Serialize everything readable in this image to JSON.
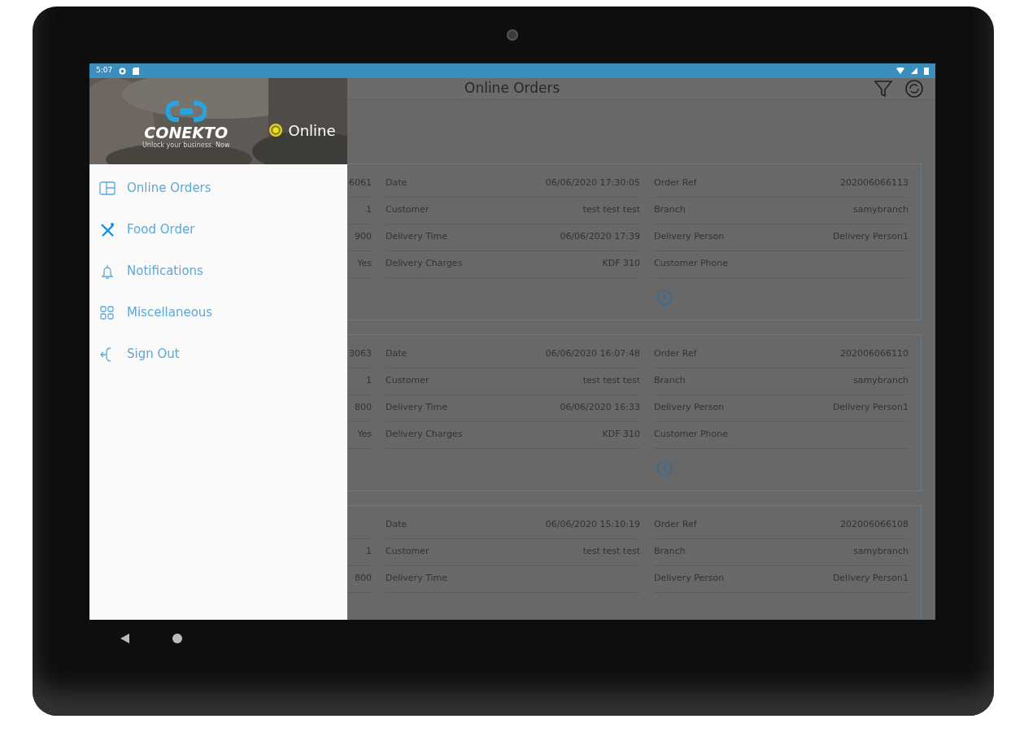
{
  "status_bar": {
    "time": "5:07"
  },
  "drawer": {
    "brand": "CONEKTO",
    "tagline": "Unlock your business. Now",
    "status": "Online",
    "items": [
      {
        "label": "Online Orders",
        "kind": "orders"
      },
      {
        "label": "Food Order",
        "kind": "food"
      },
      {
        "label": "Notifications",
        "kind": "bell"
      },
      {
        "label": "Miscellaneous",
        "kind": "grid"
      },
      {
        "label": "Sign Out",
        "kind": "signout"
      }
    ]
  },
  "app_bar": {
    "title": "Online Orders"
  },
  "orders": [
    {
      "timer": true,
      "rows": [
        {
          "column_1": "6061",
          "label_2": "Date",
          "value_2": "06/06/2020 17:30:05",
          "label_3": "Order Ref",
          "value_3": "202006066113"
        },
        {
          "column_1": "1",
          "label_2": "Customer",
          "value_2": "test test test",
          "label_3": "Branch",
          "value_3": "samybranch"
        },
        {
          "column_1": "900",
          "label_2": "Delivery Time",
          "value_2": "06/06/2020 17:39",
          "label_3": "Delivery Person",
          "value_3": "Delivery Person1"
        },
        {
          "column_1": "Yes",
          "label_2": "Delivery Charges",
          "value_2": "KDF 310",
          "label_3": "Customer Phone"
        }
      ]
    },
    {
      "timer": true,
      "rows": [
        {
          "column_1": "3063",
          "label_2": "Date",
          "value_2": "06/06/2020 16:07:48",
          "label_3": "Order Ref",
          "value_3": "202006066110"
        },
        {
          "column_1": "1",
          "label_2": "Customer",
          "value_2": "test test test",
          "label_3": "Branch",
          "value_3": "samybranch"
        },
        {
          "column_1": "800",
          "label_2": "Delivery Time",
          "value_2": "06/06/2020 16:33",
          "label_3": "Delivery Person",
          "value_3": "Delivery Person1"
        },
        {
          "column_1": "Yes",
          "label_2": "Delivery Charges",
          "value_2": "KDF 310",
          "label_3": "Customer Phone"
        }
      ]
    },
    {
      "timer": false,
      "rows": [
        {
          "label_2": "Date",
          "value_2": "06/06/2020 15:10:19",
          "label_3": "Order Ref",
          "value_3": "202006066108"
        },
        {
          "column_1": "1",
          "label_2": "Customer",
          "value_2": "test test test",
          "label_3": "Branch",
          "value_3": "samybranch"
        },
        {
          "column_1": "800",
          "label_2": "Delivery Time",
          "label_3": "Delivery Person",
          "value_3": "Delivery Person1"
        }
      ]
    }
  ]
}
